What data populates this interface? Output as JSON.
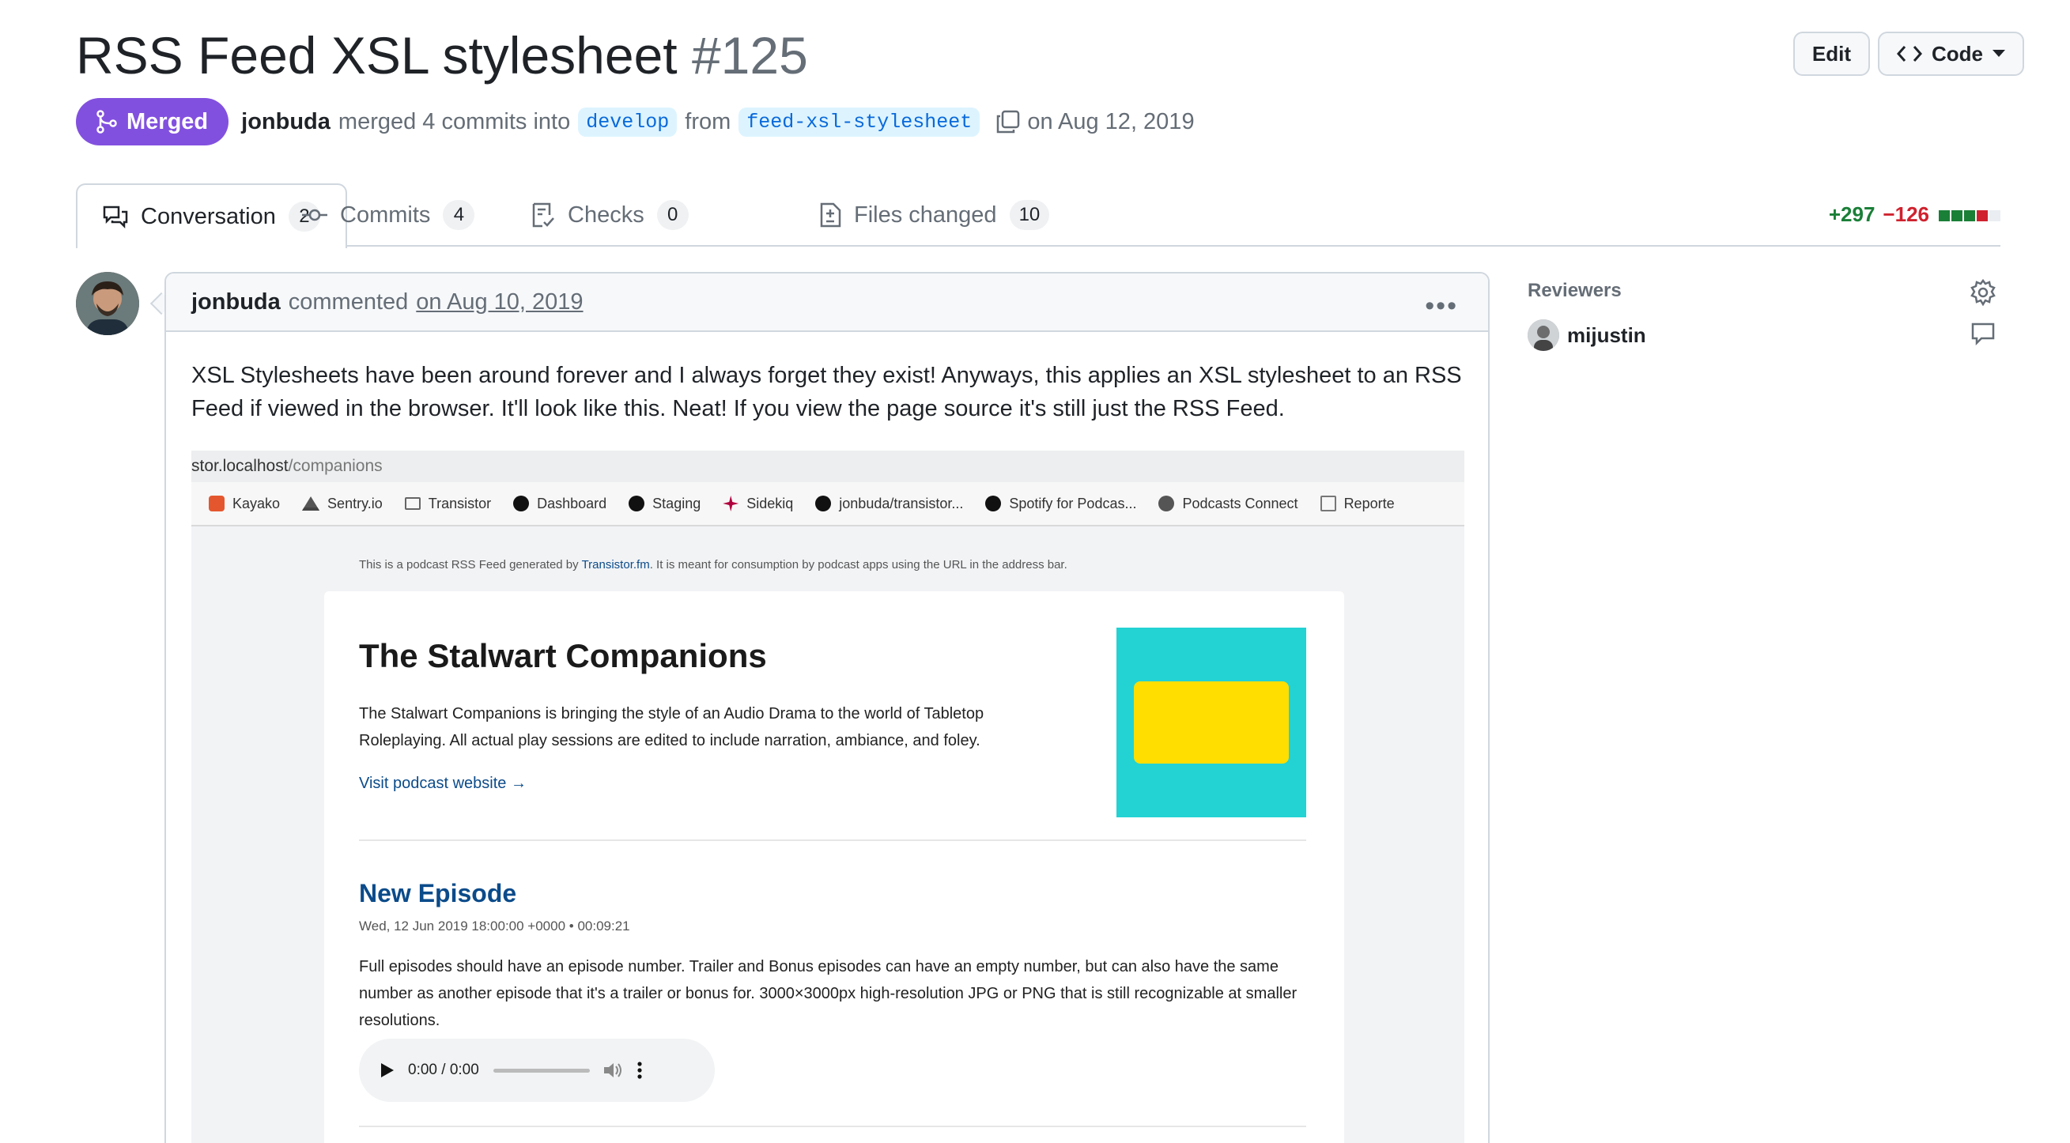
{
  "header": {
    "title": "RSS Feed XSL stylesheet",
    "number": "#125",
    "edit_label": "Edit",
    "code_label": "Code"
  },
  "meta": {
    "state": "Merged",
    "author": "jonbuda",
    "action": "merged 4 commits into",
    "base_branch": "develop",
    "from": "from",
    "head_branch": "feed-xsl-stylesheet",
    "date": "on Aug 12, 2019"
  },
  "tabs": [
    {
      "label": "Conversation",
      "count": "2"
    },
    {
      "label": "Commits",
      "count": "4"
    },
    {
      "label": "Checks",
      "count": "0"
    },
    {
      "label": "Files changed",
      "count": "10"
    }
  ],
  "diffstat": {
    "additions": "+297",
    "deletions": "−126"
  },
  "comment": {
    "author": "jonbuda",
    "action": "commented",
    "date": "on Aug 10, 2019",
    "body": "XSL Stylesheets have been around forever and I always forget they exist! Anyways, this applies an XSL stylesheet to an RSS Feed if viewed in the browser. It'll look like this. Neat! If you view the page source it's still just the RSS Feed."
  },
  "screenshot": {
    "url_host": "stor.localhost",
    "url_path": "/companions",
    "bookmarks": [
      "Kayako",
      "Sentry.io",
      "Transistor",
      "Dashboard",
      "Staging",
      "Sidekiq",
      "jonbuda/transistor...",
      "Spotify for Podcas...",
      "Podcasts Connect",
      "Reporte"
    ],
    "notice_pre": "This is a podcast RSS Feed generated by",
    "notice_link": "Transistor.fm",
    "notice_post": ". It is meant for consumption by podcast apps using the URL in the address bar.",
    "podcast_title": "The Stalwart Companions",
    "podcast_desc": "The Stalwart Companions is bringing the style of an Audio Drama to the world of Tabletop Roleplaying. All actual play sessions are edited to include narration, ambiance, and foley.",
    "podcast_link": "Visit podcast website →",
    "episode_title": "New Episode",
    "episode_date": "Wed, 12 Jun 2019 18:00:00 +0000 • 00:09:21",
    "episode_desc": "Full episodes should have an episode number. Trailer and Bonus episodes can have an empty number, but can also have the same number as another episode that it's a trailer or bonus for. 3000×3000px high-resolution JPG or PNG that is still recognizable at smaller resolutions.",
    "player_time": "0:00 / 0:00"
  },
  "sidebar": {
    "reviewers_label": "Reviewers",
    "reviewer": "mijustin"
  },
  "colors": {
    "merged": "#8250df",
    "link": "#0969da",
    "addition": "#1a7f37",
    "deletion": "#cf222e",
    "art_bg": "#23d2d3",
    "art_fg": "#ffde00"
  }
}
